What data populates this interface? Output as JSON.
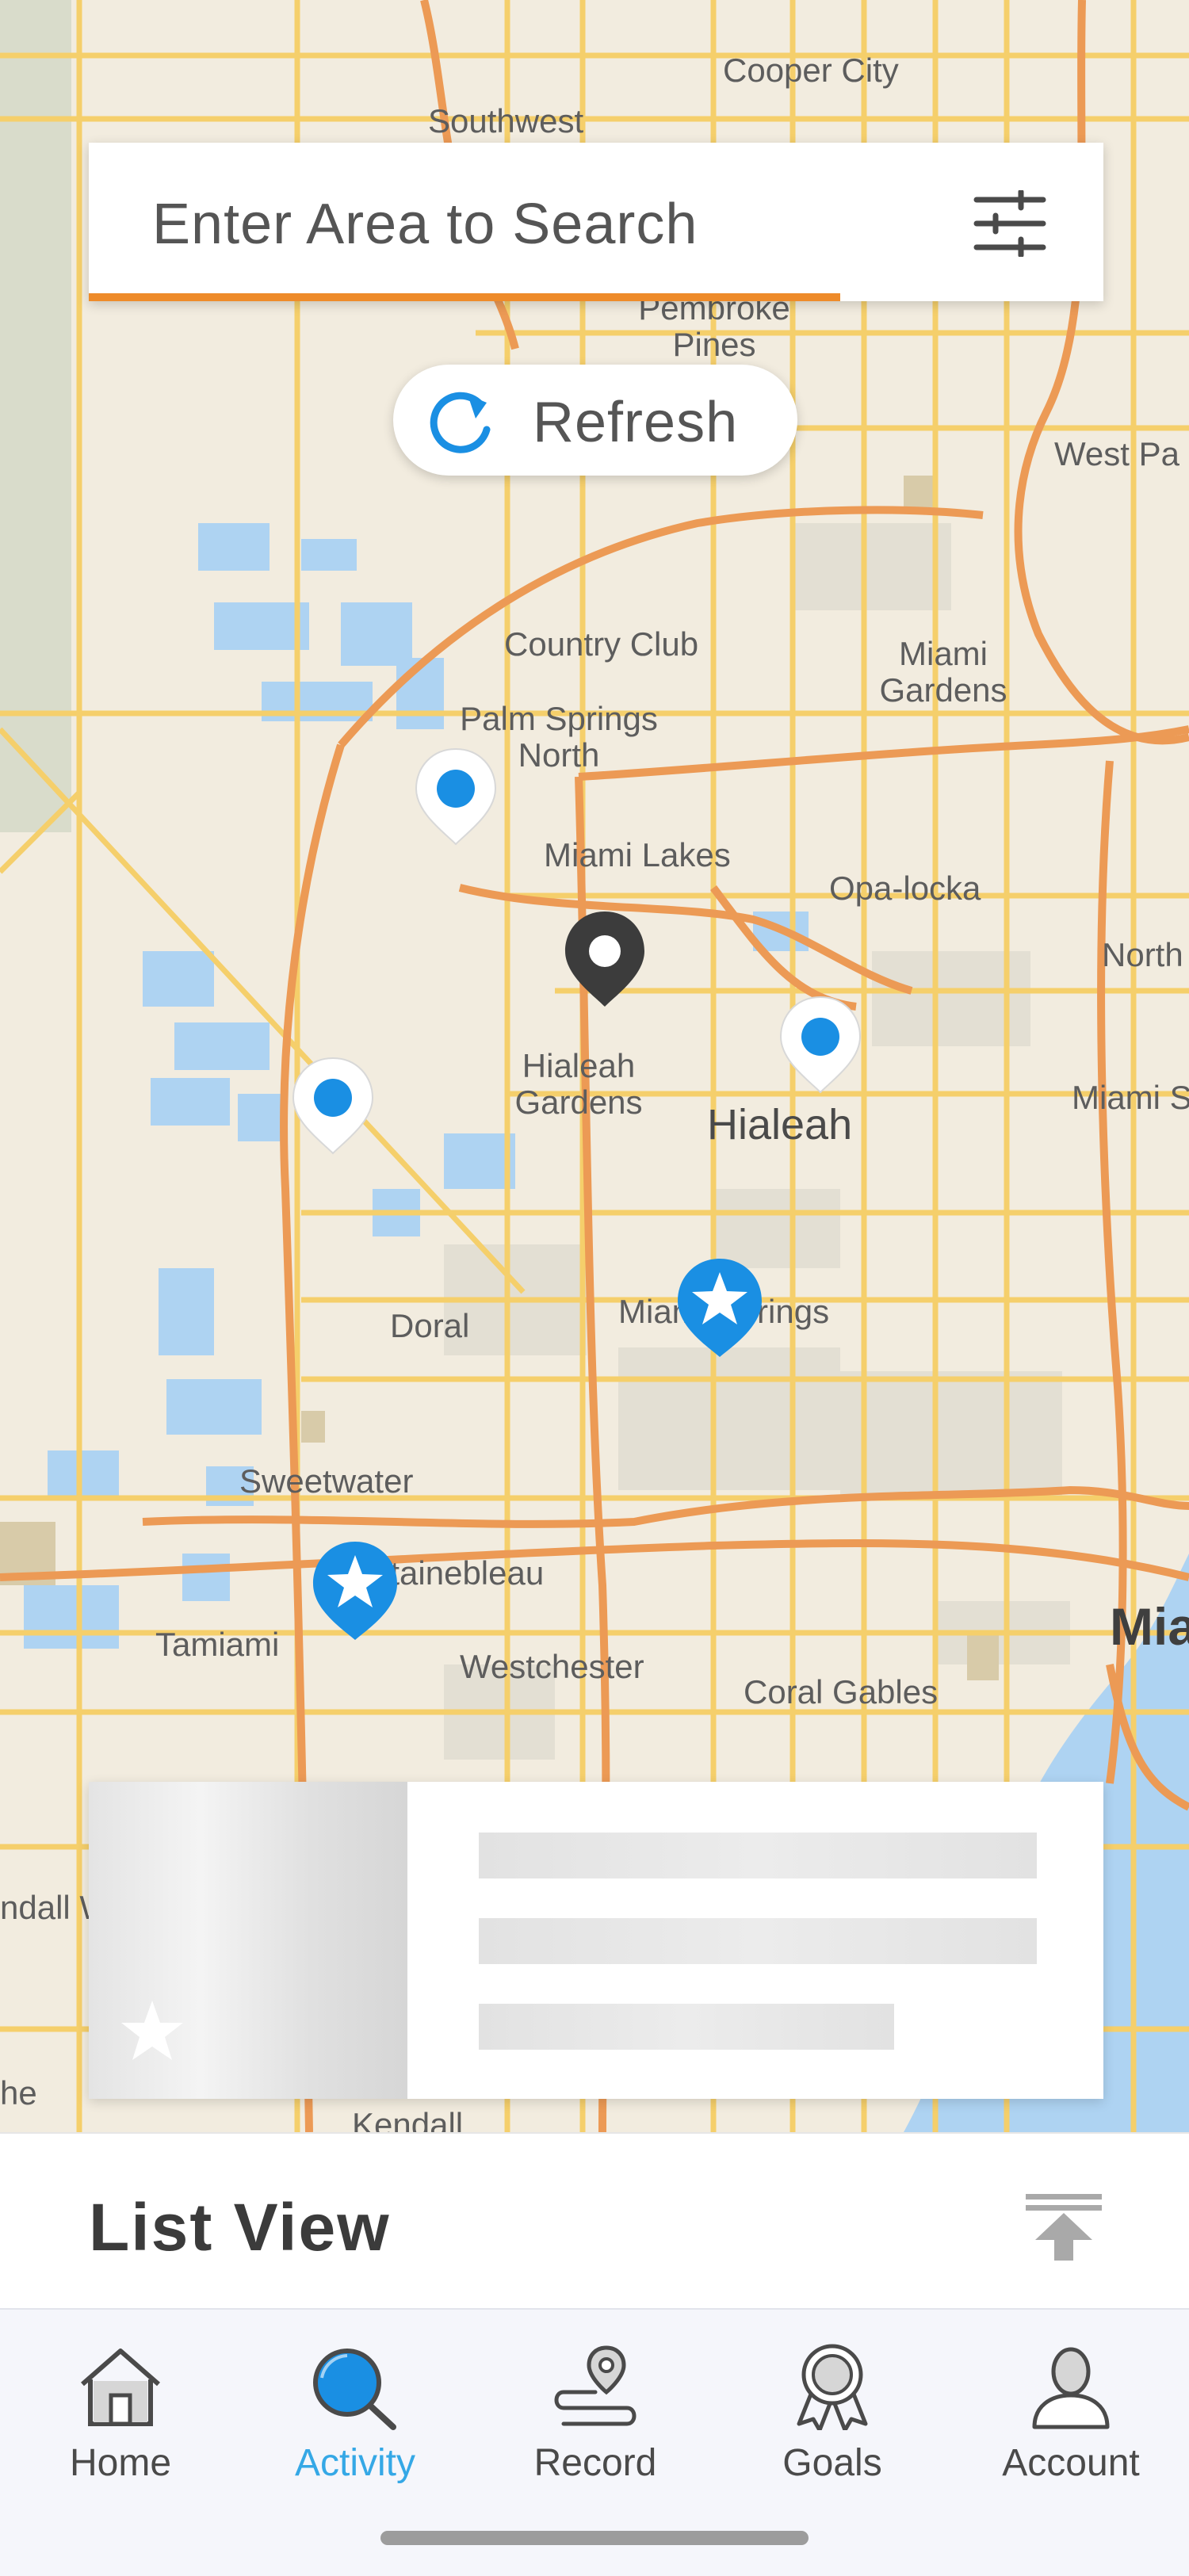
{
  "search": {
    "placeholder": "Enter Area to Search"
  },
  "refresh": {
    "label": "Refresh"
  },
  "map": {
    "labels": {
      "cooper_city": "Cooper City",
      "southwest": "Southwest",
      "pembroke_pines": "Pembroke Pines",
      "west_pa": "West Pa",
      "country_club": "Country Club",
      "miami_gardens": "Miami Gardens",
      "palm_springs_north": "Palm Springs North",
      "miami_lakes": "Miami Lakes",
      "opa_locka": "Opa-locka",
      "north": "North",
      "hialeah_gardens": "Hialeah Gardens",
      "hialeah": "Hialeah",
      "miami_s": "Miami S",
      "doral": "Doral",
      "miami_springs": "Miami Springs",
      "sweetwater": "Sweetwater",
      "fontainebleau": "Fontainebleau",
      "tamiami": "Tamiami",
      "westchester": "Westchester",
      "coral_gables": "Coral Gables",
      "mia": "Mia",
      "kendall_w": "ndall W",
      "the": "he",
      "kendall": "Kendall"
    }
  },
  "list_view": {
    "title": "List View"
  },
  "tabs": [
    {
      "label": "Home",
      "icon": "home-icon",
      "active": false
    },
    {
      "label": "Activity",
      "icon": "search-icon",
      "active": true
    },
    {
      "label": "Record",
      "icon": "location-route-icon",
      "active": false
    },
    {
      "label": "Goals",
      "icon": "award-icon",
      "active": false
    },
    {
      "label": "Account",
      "icon": "user-icon",
      "active": false
    }
  ],
  "colors": {
    "accent_orange": "#ee8b2a",
    "accent_blue": "#1a8fe3",
    "active_tab": "#35a8e6",
    "selected_pin": "#3c3c3c"
  }
}
